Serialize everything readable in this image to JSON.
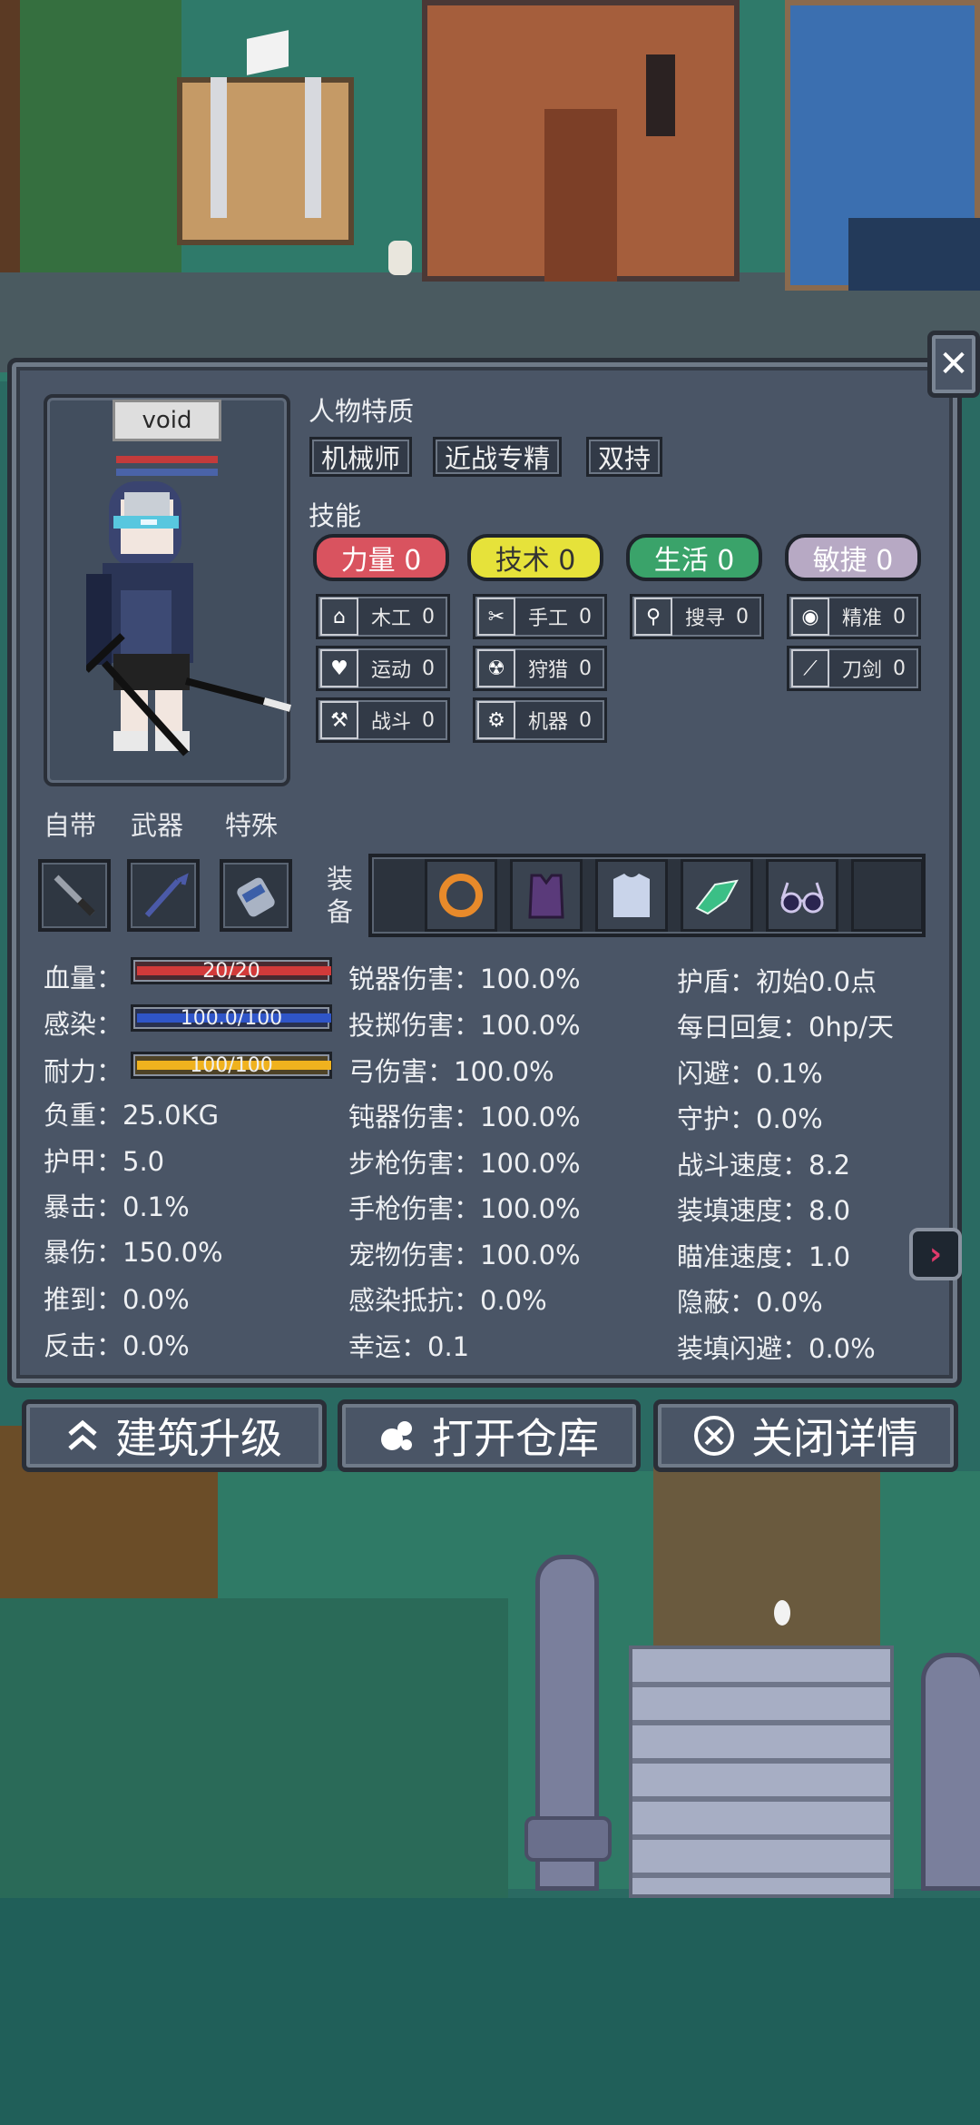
{
  "character": {
    "name": "void"
  },
  "traits": {
    "title": "人物特质",
    "items": [
      "机械师",
      "近战专精",
      "双持"
    ]
  },
  "skills": {
    "title": "技能",
    "categories": [
      {
        "label": "力量 0",
        "color": "#d9535f"
      },
      {
        "label": "技术 0",
        "color": "#e6e23a"
      },
      {
        "label": "生活 0",
        "color": "#3aa36a"
      },
      {
        "label": "敏捷 0",
        "color": "#b7a9c4"
      }
    ],
    "items": [
      {
        "label": "木工",
        "value": "0",
        "icon": "house-icon"
      },
      {
        "label": "运动",
        "value": "0",
        "icon": "heart-icon"
      },
      {
        "label": "战斗",
        "value": "0",
        "icon": "hammer-icon"
      },
      {
        "label": "手工",
        "value": "0",
        "icon": "scissors-icon"
      },
      {
        "label": "狩猎",
        "value": "0",
        "icon": "radiation-icon"
      },
      {
        "label": "机器",
        "value": "0",
        "icon": "gear-icon"
      },
      {
        "label": "搜寻",
        "value": "0",
        "icon": "magnifier-icon"
      },
      {
        "label": "精准",
        "value": "0",
        "icon": "eye-icon"
      },
      {
        "label": "刀剑",
        "value": "0",
        "icon": "sword-icon"
      }
    ]
  },
  "equipment": {
    "labels": {
      "innate": "自带",
      "weapon": "武器",
      "special": "特殊",
      "gear": "装备"
    },
    "slots": [
      "knife-icon",
      "crowbar-icon",
      "canister-icon"
    ],
    "gear": [
      "ring-icon",
      "armor-vest-icon",
      "tshirt-icon",
      "gloves-icon",
      "glasses-icon"
    ]
  },
  "vitals": {
    "hp": {
      "label": "血量：",
      "text": "20/20",
      "fill": 1.0,
      "color": "#d23a3a"
    },
    "infection": {
      "label": "感染：",
      "text": "100.0/100",
      "fill": 1.0,
      "color": "#2f55c8"
    },
    "stamina": {
      "label": "耐力：",
      "text": "100/100",
      "fill": 1.0,
      "color": "#f0b21e"
    }
  },
  "stats_col1": [
    "负重：25.0KG",
    "护甲：5.0",
    "暴击：0.1%",
    "暴伤：150.0%",
    "推到：0.0%",
    "反击：0.0%"
  ],
  "stats_col2": [
    "锐器伤害：100.0%",
    "投掷伤害：100.0%",
    "弓伤害：100.0%",
    "钝器伤害：100.0%",
    "步枪伤害：100.0%",
    "手枪伤害：100.0%",
    "宠物伤害：100.0%",
    "感染抵抗：0.0%",
    "幸运：0.1"
  ],
  "stats_col3": [
    "护盾：初始0.0点",
    "每日回复：0hp/天",
    "闪避：0.1%",
    "守护：0.0%",
    "战斗速度：8.2",
    "装填速度：8.0",
    "瞄准速度：1.0",
    "隐蔽：0.0%",
    "装填闪避：0.0%"
  ],
  "buttons": {
    "upgrade": "建筑升级",
    "warehouse": "打开仓库",
    "close_details": "关闭详情",
    "close_icon": "✕"
  }
}
